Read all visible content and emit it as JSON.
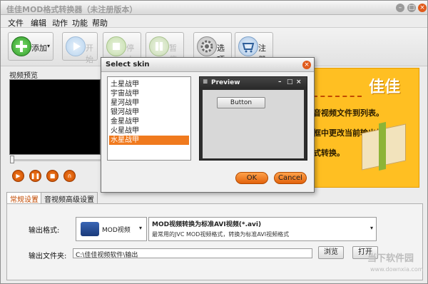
{
  "window": {
    "title": "佳佳MOD格式转换器（未注册版本）"
  },
  "menu": [
    "文件",
    "编辑",
    "动作",
    "功能",
    "帮助"
  ],
  "toolbar": {
    "add": "添加",
    "start": "开始",
    "stop": "停止",
    "pause": "暂停",
    "options": "选项",
    "register": "注册"
  },
  "preview": {
    "label": "视频预览"
  },
  "ad": {
    "brand": "佳佳",
    "line1": "音视频文件到列表。",
    "line2": "框中更改当前输出格式。",
    "line3": "式转换。"
  },
  "tabs": [
    "常规设置",
    "音视频高级设置"
  ],
  "settings": {
    "output_format_label": "输出格式:",
    "format_name": "MOD视频",
    "format_title": "MOD视频转换为标准AVI视频(*.avi)",
    "format_desc": "最常用的JVC MOD视频格式，转换为标准AVI视频格式",
    "output_folder_label": "输出文件夹:",
    "output_path": "C:\\佳佳视频软件\\输出",
    "browse": "浏览",
    "open": "打开"
  },
  "dialog": {
    "title": "Select skin",
    "skins": [
      "土星战甲",
      "宇宙战甲",
      "星河战甲",
      "银河战甲",
      "金星战甲",
      "火星战甲",
      "水星战甲"
    ],
    "selected_index": 6,
    "preview_title": "Preview",
    "preview_button": "Button",
    "ok": "OK",
    "cancel": "Cancel"
  },
  "watermark": {
    "cn": "当下软件园",
    "en": "www.downxia.com"
  },
  "colors": {
    "accent": "#f07a1e",
    "ad_bg": "#ffbf22"
  }
}
